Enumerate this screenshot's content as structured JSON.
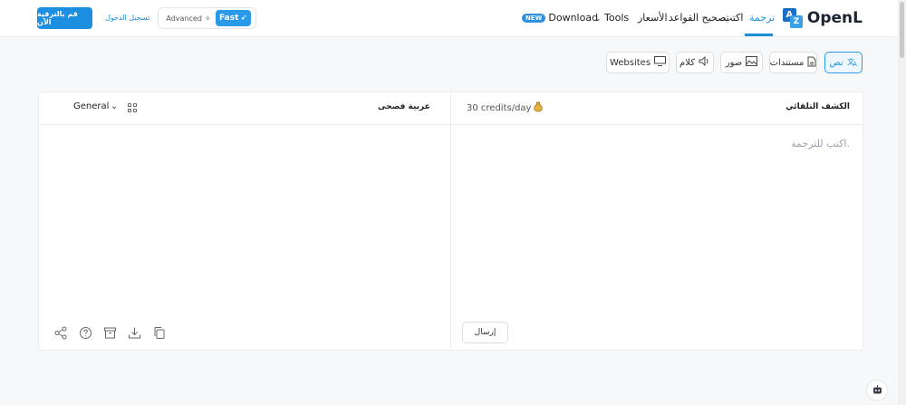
{
  "header": {
    "logo_text": "OpenL",
    "nav": {
      "translate": "ترجمة",
      "write": "اكتب",
      "grammar": "تصحيح القواعد",
      "pricing": "الأسعار",
      "tools": "Tools",
      "download_badge": "NEW",
      "download": "Download"
    },
    "mode": {
      "fast": "Fast",
      "advanced": "Advanced"
    },
    "login": "تسجيل الدخول",
    "upgrade": "قم بالترقية الآن"
  },
  "tabs": {
    "text": "نص",
    "documents": "مستندات",
    "images": "صور",
    "speech": "كلام",
    "websites": "Websites"
  },
  "translator": {
    "source_language": "الكشف التلقائي",
    "credits": "30 credits/day",
    "target_language": "عربية فصحى",
    "style": "General",
    "input_placeholder": "اكتب للترجمة.",
    "send": "إرسال"
  },
  "colors": {
    "accent": "#1d8fd8",
    "button_blue": "#1c8fe0"
  }
}
